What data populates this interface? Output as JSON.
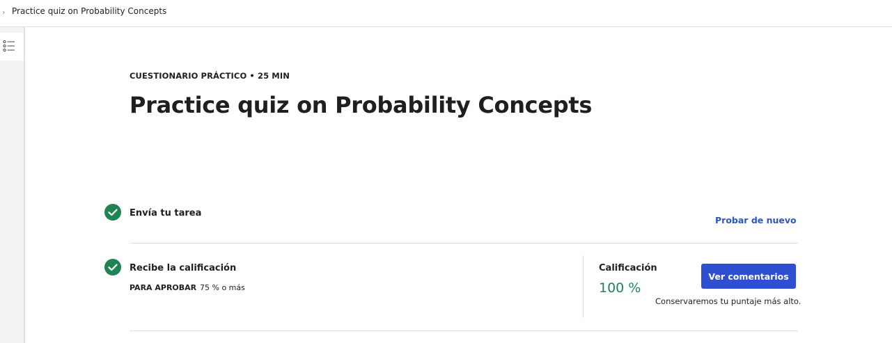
{
  "breadcrumb": {
    "chevron_icon": "chevron-right-icon",
    "label": "Practice quiz on Probability Concepts"
  },
  "sidebar": {
    "toc_icon": "list-icon"
  },
  "header": {
    "kicker": "CUESTIONARIO PRÁCTICO • 25 MIN",
    "title": "Practice quiz on Probability Concepts"
  },
  "steps": [
    {
      "icon": "check-circle-icon",
      "title": "Envía tu tarea",
      "action_label": "Probar de nuevo"
    },
    {
      "icon": "check-circle-icon",
      "title": "Recibe la calificación",
      "pass_label": "PARA APROBAR",
      "pass_value": "75 % o más"
    }
  ],
  "grade": {
    "label": "Calificación",
    "value": "100 %",
    "value_percent": 100,
    "button_label": "Ver comentarios",
    "note": "Conservaremos tu puntaje más alto."
  },
  "colors": {
    "accent_blue": "#2f4fd1",
    "link_blue": "#2a56c6",
    "success_green": "#1f8354"
  }
}
